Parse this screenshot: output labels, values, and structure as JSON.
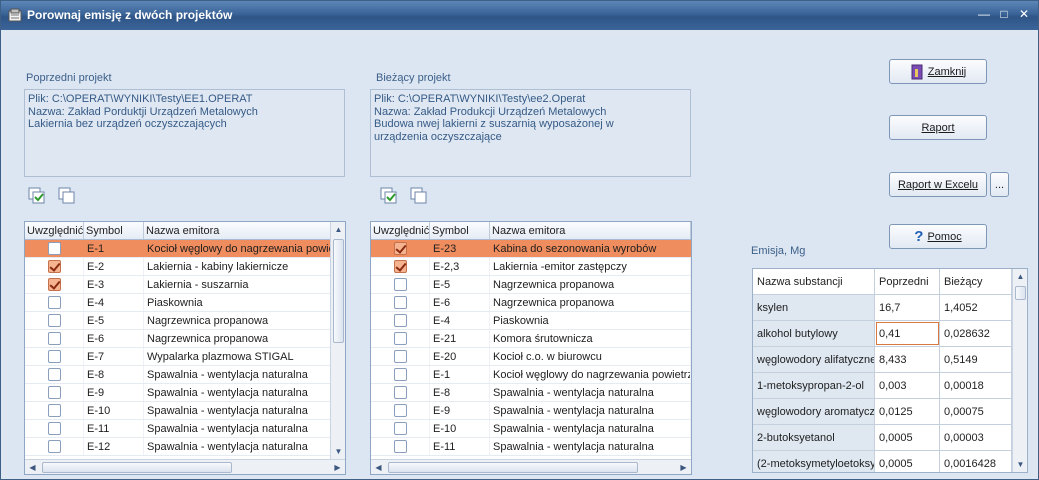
{
  "window": {
    "title": "Porownaj emisję z dwóch projektów"
  },
  "prev": {
    "label": "Poprzedni projekt",
    "lines": [
      "Plik: C:\\OPERAT\\WYNIKI\\Testy\\EE1.OPERAT",
      "Nazwa: Zakład  Porduktji Urządzeń Metalowych",
      "Lakiernia bez urządzeń oczyszczających"
    ],
    "columns": [
      "Uwzględnić",
      "Symbol",
      "Nazwa emitora"
    ],
    "rows": [
      {
        "checked": false,
        "symbol": "E-1",
        "name": "Kocioł węglowy do nagrzewania powietrza",
        "selected": true
      },
      {
        "checked": true,
        "symbol": "E-2",
        "name": "Lakiernia -  kabiny lakiernicze",
        "selected": false
      },
      {
        "checked": true,
        "symbol": "E-3",
        "name": "Lakiernia -  suszarnia",
        "selected": false
      },
      {
        "checked": false,
        "symbol": "E-4",
        "name": "Piaskownia",
        "selected": false
      },
      {
        "checked": false,
        "symbol": "E-5",
        "name": "Nagrzewnica propanowa",
        "selected": false
      },
      {
        "checked": false,
        "symbol": "E-6",
        "name": "Nagrzewnica propanowa",
        "selected": false
      },
      {
        "checked": false,
        "symbol": "E-7",
        "name": "Wypalarka plazmowa STIGAL",
        "selected": false
      },
      {
        "checked": false,
        "symbol": "E-8",
        "name": "Spawalnia - wentylacja naturalna",
        "selected": false
      },
      {
        "checked": false,
        "symbol": "E-9",
        "name": "Spawalnia - wentylacja naturalna",
        "selected": false
      },
      {
        "checked": false,
        "symbol": "E-10",
        "name": "Spawalnia - wentylacja naturalna",
        "selected": false
      },
      {
        "checked": false,
        "symbol": "E-11",
        "name": "Spawalnia - wentylacja naturalna",
        "selected": false
      },
      {
        "checked": false,
        "symbol": "E-12",
        "name": "Spawalnia - wentylacja naturalna",
        "selected": false
      }
    ]
  },
  "curr": {
    "label": "Bieżący projekt",
    "lines": [
      "Plik: C:\\OPERAT\\WYNIKI\\Testy\\ee2.Operat",
      "Nazwa: Zakład  Produkcji Urządzeń Metalowych",
      "Budowa nwej lakierni z suszarnią wyposażonej w",
      "urządzenia oczyszczające"
    ],
    "columns": [
      "Uwzględnić",
      "Symbol",
      "Nazwa emitora"
    ],
    "rows": [
      {
        "checked": true,
        "symbol": "E-23",
        "name": "Kabina do sezonowania wyrobów",
        "selected": true
      },
      {
        "checked": true,
        "symbol": "E-2,3",
        "name": "Lakiernia -emitor zastępczy",
        "selected": false
      },
      {
        "checked": false,
        "symbol": "E-5",
        "name": "Nagrzewnica propanowa",
        "selected": false
      },
      {
        "checked": false,
        "symbol": "E-6",
        "name": "Nagrzewnica propanowa",
        "selected": false
      },
      {
        "checked": false,
        "symbol": "E-4",
        "name": "Piaskownia",
        "selected": false
      },
      {
        "checked": false,
        "symbol": "E-21",
        "name": "Komora śrutownicza",
        "selected": false
      },
      {
        "checked": false,
        "symbol": "E-20",
        "name": "Kocioł c.o. w  biurowcu",
        "selected": false
      },
      {
        "checked": false,
        "symbol": "E-1",
        "name": "Kocioł węglowy do nagrzewania powietrza",
        "selected": false
      },
      {
        "checked": false,
        "symbol": "E-8",
        "name": "Spawalnia - wentylacja naturalna",
        "selected": false
      },
      {
        "checked": false,
        "symbol": "E-9",
        "name": "Spawalnia - wentylacja naturalna",
        "selected": false
      },
      {
        "checked": false,
        "symbol": "E-10",
        "name": "Spawalnia - wentylacja naturalna",
        "selected": false
      },
      {
        "checked": false,
        "symbol": "E-11",
        "name": "Spawalnia - wentylacja naturalna",
        "selected": false
      }
    ]
  },
  "buttons": {
    "close": "Zamknij",
    "report": "Raport",
    "excel": "Raport w Excelu",
    "more": "...",
    "help": "Pomoc"
  },
  "emission": {
    "label": "Emisja, Mg",
    "columns": [
      "Nazwa substancji",
      "Poprzedni",
      "Bieżący"
    ],
    "rows": [
      {
        "name": "ksylen",
        "prev": "16,7",
        "curr": "1,4052"
      },
      {
        "name": "alkohol butylowy",
        "prev": "0,41",
        "curr": "0,028632"
      },
      {
        "name": "węglowodory alifatyczne",
        "prev": "8,433",
        "curr": "0,5149"
      },
      {
        "name": "1-metoksypropan-2-ol",
        "prev": "0,003",
        "curr": "0,00018"
      },
      {
        "name": "węglowodory aromatyczne",
        "prev": "0,0125",
        "curr": "0,00075"
      },
      {
        "name": "2-butoksyetanol",
        "prev": "0,0005",
        "curr": "0,00003"
      },
      {
        "name": "(2-metoksymetyloetoksy)propanol",
        "prev": "0,0005",
        "curr": "0,0016428"
      }
    ]
  },
  "colors": {
    "selection": "#f08d5e",
    "titlebar": "#3a6397",
    "background": "#dce6f2"
  }
}
